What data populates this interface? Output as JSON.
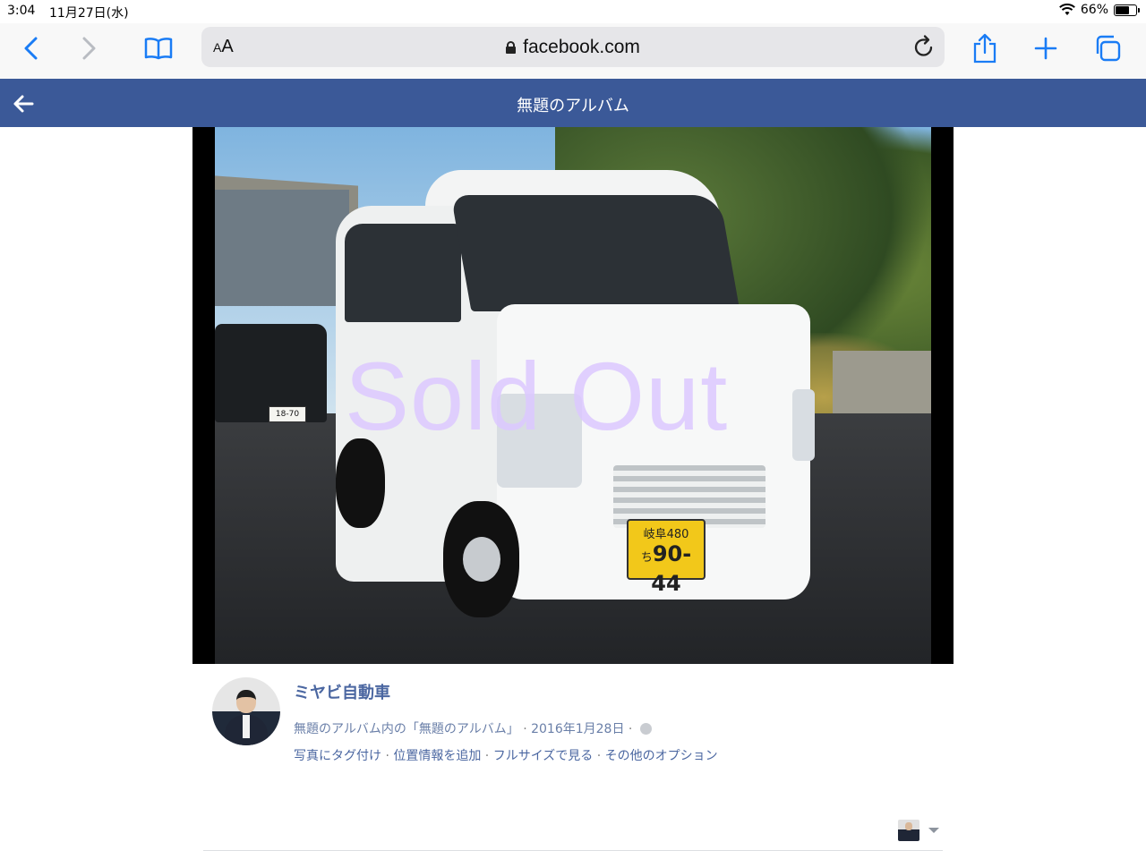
{
  "status_bar": {
    "time": "3:04",
    "date": "11月27日(水)",
    "battery": "66%",
    "battery_level": 0.66
  },
  "browser": {
    "text_size_button": "AA",
    "url": "facebook.com",
    "icons": [
      "back-chevron-icon",
      "forward-chevron-icon",
      "bookmarks-book-icon",
      "lock-icon",
      "reload-icon",
      "share-icon",
      "new-tab-plus-icon",
      "tabs-icon"
    ],
    "accent_color": "#1a7cf5"
  },
  "fb_header": {
    "title": "無題のアルバム",
    "background_color": "#3b5998"
  },
  "photo": {
    "overlay_text": "Sold Out",
    "plate_top": "岐阜480",
    "plate_kana": "ち",
    "plate_number": "90-44",
    "other_plate": "18-70"
  },
  "post": {
    "page_name": "ミヤビ自動車",
    "album_prefix": "無題のアルバム内の",
    "album_link": "「無題のアルバム」",
    "separator": " · ",
    "date": "2016年1月28日",
    "actions": [
      "写真にタグ付け",
      "位置情報を追加",
      "フルサイズで見る",
      "その他のオプション"
    ]
  }
}
